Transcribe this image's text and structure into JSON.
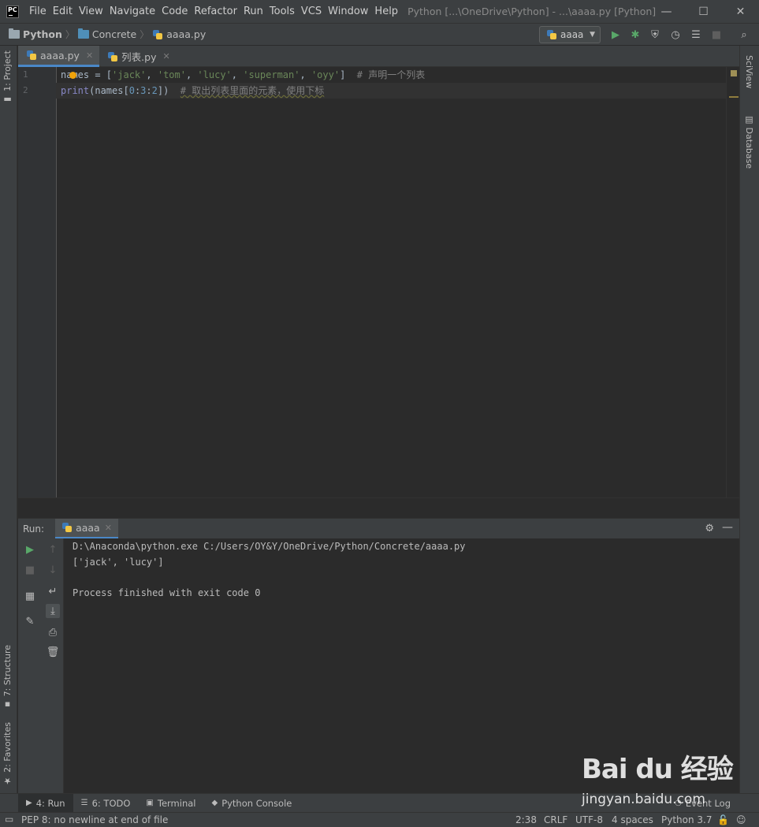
{
  "titlebar": {
    "logo": "PC",
    "menu": [
      "File",
      "Edit",
      "View",
      "Navigate",
      "Code",
      "Refactor",
      "Run",
      "Tools",
      "VCS",
      "Window",
      "Help"
    ],
    "window_title": "Python [...\\OneDrive\\Python] - ...\\aaaa.py [Python]",
    "minimize": "—",
    "maximize": "☐",
    "close": "✕"
  },
  "navbar": {
    "breadcrumbs": [
      "Python",
      "Concrete",
      "aaaa.py"
    ],
    "run_config": "aaaa",
    "colors": {
      "run": "#59a869",
      "debug": "#59a869",
      "folder_blue": "#4f8fb8",
      "folder_gray": "#9aa7b0"
    }
  },
  "left_strip": {
    "project": "1: Project",
    "structure": "7: Structure",
    "favorites": "2: Favorites"
  },
  "right_strip": {
    "sciview": "SciView",
    "database": "Database"
  },
  "editor": {
    "tabs": [
      {
        "label": "aaaa.py",
        "active": true
      },
      {
        "label": "列表.py",
        "active": false
      }
    ],
    "line_numbers": [
      "1",
      "2"
    ],
    "line1": {
      "var": "names",
      "op": " = [",
      "s1": "'jack'",
      "s2": "'tom'",
      "s3": "'lucy'",
      "s4": "'superman'",
      "s5": "'oyy'",
      "close": "]",
      "comment": "# 声明一个列表"
    },
    "line2": {
      "builtin": "print",
      "open": "(names[",
      "n0": "0",
      "n1": "3",
      "n2": "2",
      "close": "])",
      "comment": "# 取出列表里面的元素，使用下标"
    }
  },
  "run_panel": {
    "label": "Run:",
    "tab": "aaaa",
    "output": [
      "D:\\Anaconda\\python.exe C:/Users/OY&Y/OneDrive/Python/Concrete/aaaa.py",
      "['jack', 'lucy']",
      "",
      "Process finished with exit code 0"
    ]
  },
  "bottom_tabs": [
    {
      "label": "4: Run",
      "icon": "▶"
    },
    {
      "label": "6: TODO",
      "icon": "☰"
    },
    {
      "label": "Terminal",
      "icon": "▣"
    },
    {
      "label": "Python Console",
      "icon": "◆"
    }
  ],
  "event_log": "Event Log",
  "statusbar": {
    "message": "PEP 8: no newline at end of file",
    "position": "2:38",
    "line_sep": "CRLF",
    "encoding": "UTF-8",
    "indent": "4 spaces",
    "interpreter": "Python 3.7"
  },
  "watermark": {
    "text": "Bai du 经验",
    "url": "jingyan.baidu.com"
  }
}
